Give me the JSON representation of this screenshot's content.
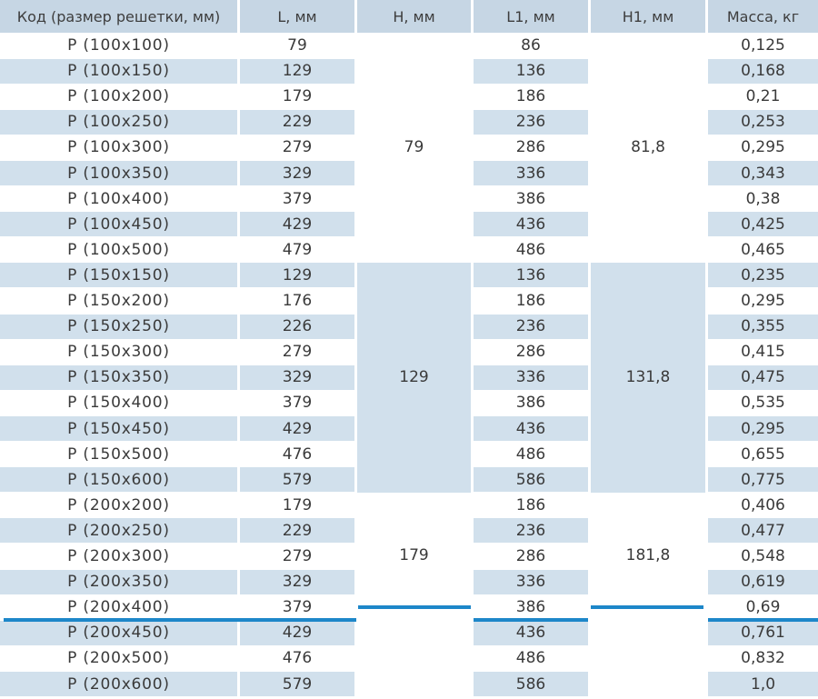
{
  "headers": [
    "Код (размер решетки, мм)",
    "L, мм",
    "H, мм",
    "L1, мм",
    "H1, мм",
    "Масса, кг"
  ],
  "groups": [
    {
      "h": "79",
      "h1": "81,8"
    },
    {
      "h": "129",
      "h1": "131,8"
    },
    {
      "h": "179",
      "h1": "181,8"
    }
  ],
  "rows": [
    {
      "code": "Р (100х100)",
      "l": "79",
      "l1": "86",
      "mass": "0,125",
      "group": 0
    },
    {
      "code": "Р (100х150)",
      "l": "129",
      "l1": "136",
      "mass": "0,168",
      "group": 0
    },
    {
      "code": "Р (100х200)",
      "l": "179",
      "l1": "186",
      "mass": "0,21",
      "group": 0
    },
    {
      "code": "Р (100х250)",
      "l": "229",
      "l1": "236",
      "mass": "0,253",
      "group": 0
    },
    {
      "code": "Р (100х300)",
      "l": "279",
      "l1": "286",
      "mass": "0,295",
      "group": 0
    },
    {
      "code": "Р (100х350)",
      "l": "329",
      "l1": "336",
      "mass": "0,343",
      "group": 0
    },
    {
      "code": "Р (100х400)",
      "l": "379",
      "l1": "386",
      "mass": "0,38",
      "group": 0
    },
    {
      "code": "Р (100х450)",
      "l": "429",
      "l1": "436",
      "mass": "0,425",
      "group": 0
    },
    {
      "code": "Р (100х500)",
      "l": "479",
      "l1": "486",
      "mass": "0,465",
      "group": 0
    },
    {
      "code": "Р (150х150)",
      "l": "129",
      "l1": "136",
      "mass": "0,235",
      "group": 1
    },
    {
      "code": "Р (150х200)",
      "l": "176",
      "l1": "186",
      "mass": "0,295",
      "group": 1
    },
    {
      "code": "Р (150х250)",
      "l": "226",
      "l1": "236",
      "mass": "0,355",
      "group": 1
    },
    {
      "code": "Р (150х300)",
      "l": "279",
      "l1": "286",
      "mass": "0,415",
      "group": 1
    },
    {
      "code": "Р (150х350)",
      "l": "329",
      "l1": "336",
      "mass": "0,475",
      "group": 1
    },
    {
      "code": "Р (150х400)",
      "l": "379",
      "l1": "386",
      "mass": "0,535",
      "group": 1
    },
    {
      "code": "Р (150х450)",
      "l": "429",
      "l1": "436",
      "mass": "0,295",
      "group": 1
    },
    {
      "code": "Р (150х500)",
      "l": "476",
      "l1": "486",
      "mass": "0,655",
      "group": 1
    },
    {
      "code": "Р (150х600)",
      "l": "579",
      "l1": "586",
      "mass": "0,775",
      "group": 1
    },
    {
      "code": "Р (200х200)",
      "l": "179",
      "l1": "186",
      "mass": "0,406",
      "group": 2
    },
    {
      "code": "Р (200х250)",
      "l": "229",
      "l1": "236",
      "mass": "0,477",
      "group": 2
    },
    {
      "code": "Р (200х300)",
      "l": "279",
      "l1": "286",
      "mass": "0,548",
      "group": 2
    },
    {
      "code": "Р (200х350)",
      "l": "329",
      "l1": "336",
      "mass": "0,619",
      "group": 2
    },
    {
      "code": "Р (200х400)",
      "l": "379",
      "l1": "386",
      "mass": "0,69",
      "group": 2
    },
    {
      "code": "Р (200х450)",
      "l": "429",
      "l1": "436",
      "mass": "0,761",
      "group": 2
    },
    {
      "code": "Р (200х500)",
      "l": "476",
      "l1": "486",
      "mass": "0,832",
      "group": 2
    },
    {
      "code": "Р (200х600)",
      "l": "579",
      "l1": "586",
      "mass": "1,0",
      "group": 2
    }
  ],
  "colors": {
    "header_bg": "#c6d6e4",
    "row_shade": "#d1e0ec",
    "highlight_line": "#1d87c9"
  }
}
